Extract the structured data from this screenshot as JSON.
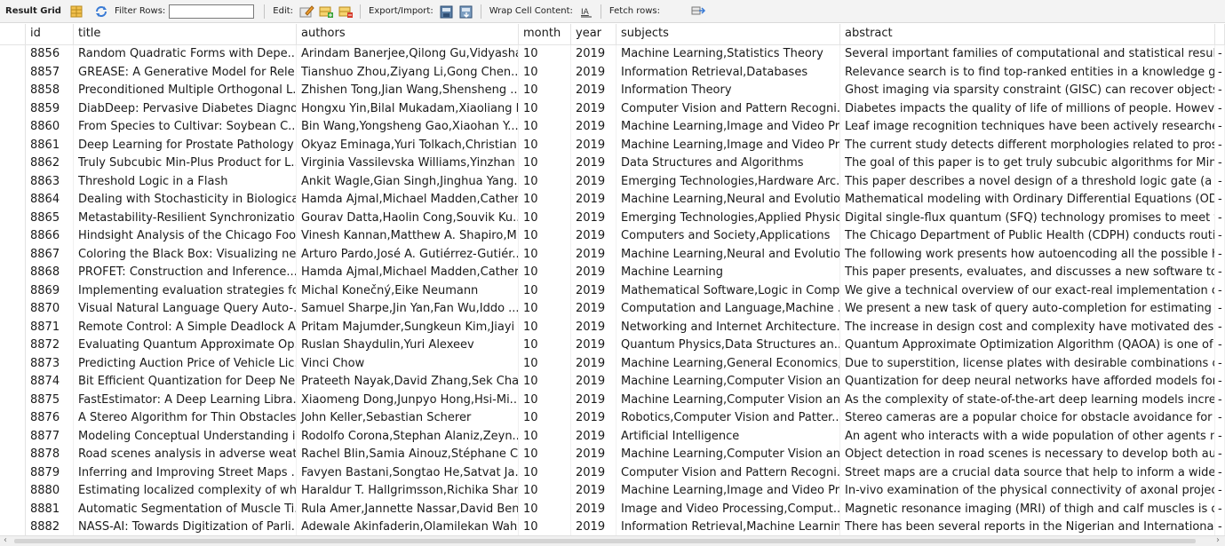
{
  "toolbar": {
    "title": "Result Grid",
    "filter_label": "Filter Rows:",
    "filter_value": "",
    "edit_label": "Edit:",
    "export_label": "Export/Import:",
    "wrap_label": "Wrap Cell Content:",
    "fetch_label": "Fetch rows:"
  },
  "columns": [
    "id",
    "title",
    "authors",
    "month",
    "year",
    "subjects",
    "abstract"
  ],
  "rows": [
    [
      "8856",
      "Random Quadratic Forms with Depe...",
      "Arindam Banerjee,Qilong Gu,Vidyasha...",
      "10",
      "2019",
      "Machine Learning,Statistics Theory",
      "Several important families of computational and statistical results i...",
      "-"
    ],
    [
      "8857",
      "GREASE: A Generative Model for Rele...",
      "Tianshuo Zhou,Ziyang Li,Gong Chen...",
      "10",
      "2019",
      "Information Retrieval,Databases",
      "Relevance search is to find top-ranked entities in a knowledge gra...",
      "-"
    ],
    [
      "8858",
      "Preconditioned Multiple Orthogonal L...",
      "Zhishen Tong,Jian Wang,Shensheng ...",
      "10",
      "2019",
      "Information Theory",
      "Ghost imaging via sparsity constraint (GISC) can recover objects ...",
      "-"
    ],
    [
      "8859",
      "DiabDeep: Pervasive Diabetes Diagno...",
      "Hongxu Yin,Bilal Mukadam,Xiaoliang D...",
      "10",
      "2019",
      "Computer Vision and Pattern Recogni...",
      "Diabetes impacts the quality of life of millions of people. However, ...",
      "-"
    ],
    [
      "8860",
      "From Species to Cultivar: Soybean C...",
      "Bin Wang,Yongsheng Gao,Xiaohan Y...",
      "10",
      "2019",
      "Machine Learning,Image and Video Pr...",
      "Leaf image recognition techniques have been actively researched...",
      "-"
    ],
    [
      "8861",
      "Deep Learning for Prostate Pathology",
      "Okyaz Eminaga,Yuri Tolkach,Christian...",
      "10",
      "2019",
      "Machine Learning,Image and Video Pr...",
      "The current study detects different morphologies related to prost...",
      "-"
    ],
    [
      "8862",
      "Truly Subcubic Min-Plus Product for L...",
      "Virginia Vassilevska Williams,Yinzhan Xu",
      "10",
      "2019",
      "Data Structures and Algorithms",
      "The goal of this paper is to get truly subcubic algorithms for Min-...",
      "-"
    ],
    [
      "8863",
      "Threshold Logic in a Flash",
      "Ankit Wagle,Gian Singh,Jinghua Yang...",
      "10",
      "2019",
      "Emerging Technologies,Hardware Arc...",
      "This paper describes a novel design of a threshold logic gate (a bi...",
      "-"
    ],
    [
      "8864",
      "Dealing with Stochasticity in Biological...",
      "Hamda Ajmal,Michael Madden,Catheri...",
      "10",
      "2019",
      "Machine Learning,Neural and Evolutio...",
      "Mathematical modeling with Ordinary Differential Equations (ODEs...",
      "-"
    ],
    [
      "8865",
      "Metastability-Resilient Synchronization...",
      "Gourav Datta,Haolin Cong,Souvik Ku...",
      "10",
      "2019",
      "Emerging Technologies,Applied Physics",
      "Digital single-flux quantum (SFQ) technology promises to meet th...",
      "-"
    ],
    [
      "8866",
      "Hindsight Analysis of the Chicago Foo...",
      "Vinesh Kannan,Matthew A. Shapiro,M...",
      "10",
      "2019",
      "Computers and Society,Applications",
      "The Chicago Department of Public Health (CDPH) conducts routi...",
      "-"
    ],
    [
      "8867",
      "Coloring the Black Box: Visualizing ne...",
      "Arturo Pardo,José A. Gutiérrez-Gutiér...",
      "10",
      "2019",
      "Machine Learning,Neural and Evolutio...",
      "The following work presents how autoencoding all the possible hid...",
      "-"
    ],
    [
      "8868",
      "PROFET: Construction and Inference...",
      "Hamda Ajmal,Michael Madden,Catheri...",
      "10",
      "2019",
      "Machine Learning",
      "This paper presents, evaluates, and discusses a new software tool...",
      "-"
    ],
    [
      "8869",
      "Implementing evaluation strategies fo...",
      "Michal Konečný,Eike Neumann",
      "10",
      "2019",
      "Mathematical Software,Logic in Comp...",
      "We give a technical overview of our exact-real implementation of ...",
      "-"
    ],
    [
      "8870",
      "Visual Natural Language Query Auto-...",
      "Samuel Sharpe,Jin Yan,Fan Wu,Iddo ...",
      "10",
      "2019",
      "Computation and Language,Machine ...",
      "We present a new task of query auto-completion for estimating i...",
      "-"
    ],
    [
      "8871",
      "Remote Control: A Simple Deadlock A...",
      "Pritam Majumder,Sungkeun Kim,Jiayi ...",
      "10",
      "2019",
      "Networking and Internet Architecture...",
      "The increase in design cost and complexity have motivated desig...",
      "-"
    ],
    [
      "8872",
      "Evaluating Quantum Approximate Op...",
      "Ruslan Shaydulin,Yuri Alexeev",
      "10",
      "2019",
      "Quantum Physics,Data Structures an...",
      "Quantum Approximate Optimization Algorithm (QAOA) is one of t...",
      "-"
    ],
    [
      "8873",
      "Predicting Auction Price of Vehicle Lic...",
      "Vinci Chow",
      "10",
      "2019",
      "Machine Learning,General Economics,...",
      "Due to superstition, license plates with desirable combinations of c...",
      "-"
    ],
    [
      "8874",
      "Bit Efficient Quantization for Deep Ne...",
      "Prateeth Nayak,David Zhang,Sek Chai",
      "10",
      "2019",
      "Machine Learning,Computer Vision an...",
      "Quantization for deep neural networks have afforded models for ...",
      "-"
    ],
    [
      "8875",
      "FastEstimator: A Deep Learning Libra...",
      "Xiaomeng Dong,Junpyo Hong,Hsi-Mi...",
      "10",
      "2019",
      "Machine Learning,Computer Vision an...",
      "As the complexity of state-of-the-art deep learning models increa...",
      "-"
    ],
    [
      "8876",
      "A Stereo Algorithm for Thin Obstacles...",
      "John Keller,Sebastian Scherer",
      "10",
      "2019",
      "Robotics,Computer Vision and Patter...",
      "Stereo cameras are a popular choice for obstacle avoidance for o...",
      "-"
    ],
    [
      "8877",
      "Modeling Conceptual Understanding i...",
      "Rodolfo Corona,Stephan Alaniz,Zeyn...",
      "10",
      "2019",
      "Artificial Intelligence",
      "An agent who interacts with a wide population of other agents ne...",
      "-"
    ],
    [
      "8878",
      "Road scenes analysis in adverse weat...",
      "Rachel Blin,Samia Ainouz,Stéphane C...",
      "10",
      "2019",
      "Machine Learning,Computer Vision an...",
      "Object detection in road scenes is necessary to develop both aut...",
      "-"
    ],
    [
      "8879",
      "Inferring and Improving Street Maps ...",
      "Favyen Bastani,Songtao He,Satvat Ja...",
      "10",
      "2019",
      "Computer Vision and Pattern Recogni...",
      "Street maps are a crucial data source that help to inform a wide r...",
      "-"
    ],
    [
      "8880",
      "Estimating localized complexity of whi...",
      "Haraldur T. Hallgrimsson,Richika Shar...",
      "10",
      "2019",
      "Machine Learning,Image and Video Pr...",
      "In-vivo examination of the physical connectivity of axonal projec...",
      "-"
    ],
    [
      "8881",
      "Automatic Segmentation of Muscle Ti...",
      "Rula Amer,Jannette Nassar,David Ben...",
      "10",
      "2019",
      "Image and Video Processing,Comput...",
      "Magnetic resonance imaging (MRI) of thigh and calf muscles is on...",
      "-"
    ],
    [
      "8882",
      "NASS-AI: Towards Digitization of Parli...",
      "Adewale Akinfaderin,Olamilekan Wahab",
      "10",
      "2019",
      "Information Retrieval,Machine Learnin...",
      "There has been several reports in the Nigerian and International ...",
      "-"
    ]
  ],
  "icons": [
    "grid-layout-icon",
    "refresh-icon",
    "edit-row-icon",
    "add-row-icon",
    "delete-row-icon",
    "export-icon",
    "import-icon",
    "wrap-cell-icon",
    "fetch-rows-icon"
  ]
}
